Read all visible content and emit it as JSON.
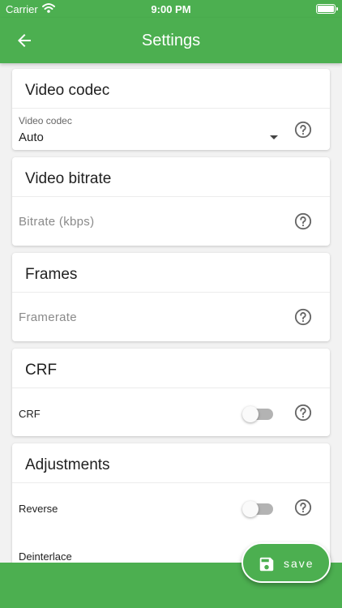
{
  "status_bar": {
    "carrier": "Carrier",
    "time": "9:00 PM"
  },
  "app_bar": {
    "title": "Settings"
  },
  "cards": {
    "video_codec": {
      "title": "Video codec",
      "field_label": "Video codec",
      "value": "Auto"
    },
    "video_bitrate": {
      "title": "Video bitrate",
      "placeholder": "Bitrate (kbps)"
    },
    "frames": {
      "title": "Frames",
      "placeholder": "Framerate"
    },
    "crf": {
      "title": "CRF",
      "toggle_label": "CRF"
    },
    "adjustments": {
      "title": "Adjustments",
      "reverse_label": "Reverse",
      "deinterlace_label": "Deinterlace"
    }
  },
  "fab": {
    "label": "save"
  },
  "icons": {
    "back": "arrow-left-icon",
    "help": "help-circle-icon",
    "save": "floppy-disk-icon",
    "wifi": "wifi-icon",
    "battery": "battery-icon"
  },
  "colors": {
    "primary": "#4caf50",
    "background": "#f2f2f2",
    "card": "#ffffff"
  }
}
